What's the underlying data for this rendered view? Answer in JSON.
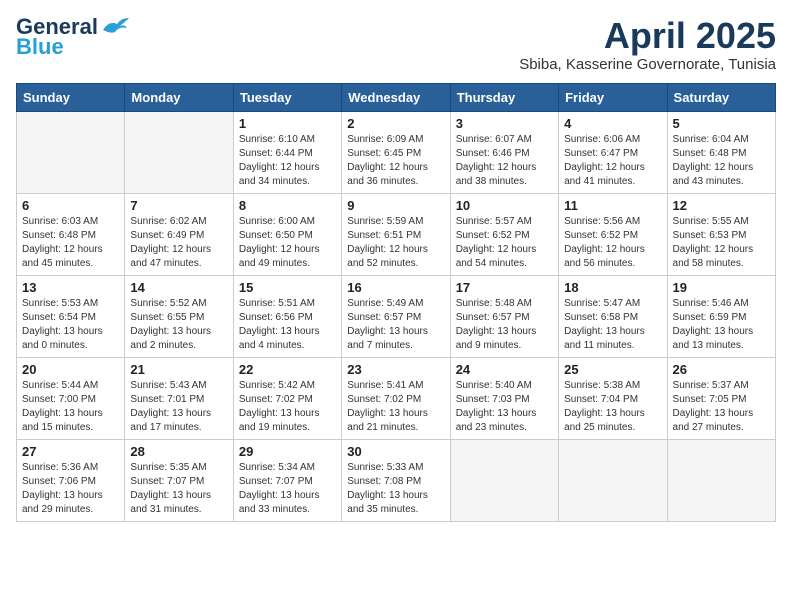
{
  "header": {
    "logo_line1": "General",
    "logo_line2": "Blue",
    "month_year": "April 2025",
    "location": "Sbiba, Kasserine Governorate, Tunisia"
  },
  "weekdays": [
    "Sunday",
    "Monday",
    "Tuesday",
    "Wednesday",
    "Thursday",
    "Friday",
    "Saturday"
  ],
  "weeks": [
    [
      {
        "day": "",
        "sunrise": "",
        "sunset": "",
        "daylight": ""
      },
      {
        "day": "",
        "sunrise": "",
        "sunset": "",
        "daylight": ""
      },
      {
        "day": "1",
        "sunrise": "Sunrise: 6:10 AM",
        "sunset": "Sunset: 6:44 PM",
        "daylight": "Daylight: 12 hours and 34 minutes."
      },
      {
        "day": "2",
        "sunrise": "Sunrise: 6:09 AM",
        "sunset": "Sunset: 6:45 PM",
        "daylight": "Daylight: 12 hours and 36 minutes."
      },
      {
        "day": "3",
        "sunrise": "Sunrise: 6:07 AM",
        "sunset": "Sunset: 6:46 PM",
        "daylight": "Daylight: 12 hours and 38 minutes."
      },
      {
        "day": "4",
        "sunrise": "Sunrise: 6:06 AM",
        "sunset": "Sunset: 6:47 PM",
        "daylight": "Daylight: 12 hours and 41 minutes."
      },
      {
        "day": "5",
        "sunrise": "Sunrise: 6:04 AM",
        "sunset": "Sunset: 6:48 PM",
        "daylight": "Daylight: 12 hours and 43 minutes."
      }
    ],
    [
      {
        "day": "6",
        "sunrise": "Sunrise: 6:03 AM",
        "sunset": "Sunset: 6:48 PM",
        "daylight": "Daylight: 12 hours and 45 minutes."
      },
      {
        "day": "7",
        "sunrise": "Sunrise: 6:02 AM",
        "sunset": "Sunset: 6:49 PM",
        "daylight": "Daylight: 12 hours and 47 minutes."
      },
      {
        "day": "8",
        "sunrise": "Sunrise: 6:00 AM",
        "sunset": "Sunset: 6:50 PM",
        "daylight": "Daylight: 12 hours and 49 minutes."
      },
      {
        "day": "9",
        "sunrise": "Sunrise: 5:59 AM",
        "sunset": "Sunset: 6:51 PM",
        "daylight": "Daylight: 12 hours and 52 minutes."
      },
      {
        "day": "10",
        "sunrise": "Sunrise: 5:57 AM",
        "sunset": "Sunset: 6:52 PM",
        "daylight": "Daylight: 12 hours and 54 minutes."
      },
      {
        "day": "11",
        "sunrise": "Sunrise: 5:56 AM",
        "sunset": "Sunset: 6:52 PM",
        "daylight": "Daylight: 12 hours and 56 minutes."
      },
      {
        "day": "12",
        "sunrise": "Sunrise: 5:55 AM",
        "sunset": "Sunset: 6:53 PM",
        "daylight": "Daylight: 12 hours and 58 minutes."
      }
    ],
    [
      {
        "day": "13",
        "sunrise": "Sunrise: 5:53 AM",
        "sunset": "Sunset: 6:54 PM",
        "daylight": "Daylight: 13 hours and 0 minutes."
      },
      {
        "day": "14",
        "sunrise": "Sunrise: 5:52 AM",
        "sunset": "Sunset: 6:55 PM",
        "daylight": "Daylight: 13 hours and 2 minutes."
      },
      {
        "day": "15",
        "sunrise": "Sunrise: 5:51 AM",
        "sunset": "Sunset: 6:56 PM",
        "daylight": "Daylight: 13 hours and 4 minutes."
      },
      {
        "day": "16",
        "sunrise": "Sunrise: 5:49 AM",
        "sunset": "Sunset: 6:57 PM",
        "daylight": "Daylight: 13 hours and 7 minutes."
      },
      {
        "day": "17",
        "sunrise": "Sunrise: 5:48 AM",
        "sunset": "Sunset: 6:57 PM",
        "daylight": "Daylight: 13 hours and 9 minutes."
      },
      {
        "day": "18",
        "sunrise": "Sunrise: 5:47 AM",
        "sunset": "Sunset: 6:58 PM",
        "daylight": "Daylight: 13 hours and 11 minutes."
      },
      {
        "day": "19",
        "sunrise": "Sunrise: 5:46 AM",
        "sunset": "Sunset: 6:59 PM",
        "daylight": "Daylight: 13 hours and 13 minutes."
      }
    ],
    [
      {
        "day": "20",
        "sunrise": "Sunrise: 5:44 AM",
        "sunset": "Sunset: 7:00 PM",
        "daylight": "Daylight: 13 hours and 15 minutes."
      },
      {
        "day": "21",
        "sunrise": "Sunrise: 5:43 AM",
        "sunset": "Sunset: 7:01 PM",
        "daylight": "Daylight: 13 hours and 17 minutes."
      },
      {
        "day": "22",
        "sunrise": "Sunrise: 5:42 AM",
        "sunset": "Sunset: 7:02 PM",
        "daylight": "Daylight: 13 hours and 19 minutes."
      },
      {
        "day": "23",
        "sunrise": "Sunrise: 5:41 AM",
        "sunset": "Sunset: 7:02 PM",
        "daylight": "Daylight: 13 hours and 21 minutes."
      },
      {
        "day": "24",
        "sunrise": "Sunrise: 5:40 AM",
        "sunset": "Sunset: 7:03 PM",
        "daylight": "Daylight: 13 hours and 23 minutes."
      },
      {
        "day": "25",
        "sunrise": "Sunrise: 5:38 AM",
        "sunset": "Sunset: 7:04 PM",
        "daylight": "Daylight: 13 hours and 25 minutes."
      },
      {
        "day": "26",
        "sunrise": "Sunrise: 5:37 AM",
        "sunset": "Sunset: 7:05 PM",
        "daylight": "Daylight: 13 hours and 27 minutes."
      }
    ],
    [
      {
        "day": "27",
        "sunrise": "Sunrise: 5:36 AM",
        "sunset": "Sunset: 7:06 PM",
        "daylight": "Daylight: 13 hours and 29 minutes."
      },
      {
        "day": "28",
        "sunrise": "Sunrise: 5:35 AM",
        "sunset": "Sunset: 7:07 PM",
        "daylight": "Daylight: 13 hours and 31 minutes."
      },
      {
        "day": "29",
        "sunrise": "Sunrise: 5:34 AM",
        "sunset": "Sunset: 7:07 PM",
        "daylight": "Daylight: 13 hours and 33 minutes."
      },
      {
        "day": "30",
        "sunrise": "Sunrise: 5:33 AM",
        "sunset": "Sunset: 7:08 PM",
        "daylight": "Daylight: 13 hours and 35 minutes."
      },
      {
        "day": "",
        "sunrise": "",
        "sunset": "",
        "daylight": ""
      },
      {
        "day": "",
        "sunrise": "",
        "sunset": "",
        "daylight": ""
      },
      {
        "day": "",
        "sunrise": "",
        "sunset": "",
        "daylight": ""
      }
    ]
  ]
}
